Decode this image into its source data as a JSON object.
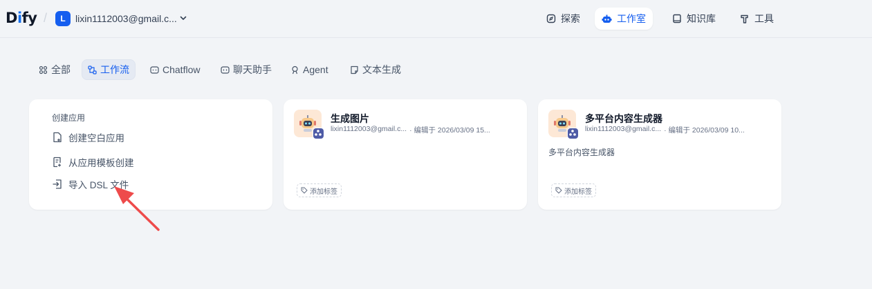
{
  "header": {
    "logo_text": "Dify",
    "workspace_initial": "L",
    "workspace_name": "lixin1112003@gmail.c...",
    "nav": [
      {
        "label": "探索",
        "icon": "compass-icon"
      },
      {
        "label": "工作室",
        "icon": "robot-icon",
        "active": true
      },
      {
        "label": "知识库",
        "icon": "book-icon"
      },
      {
        "label": "工具",
        "icon": "hammer-icon"
      }
    ]
  },
  "tabs": [
    {
      "label": "全部",
      "icon": "grid-icon"
    },
    {
      "label": "工作流",
      "icon": "workflow-icon",
      "active": true
    },
    {
      "label": "Chatflow",
      "icon": "chat-bubble-icon"
    },
    {
      "label": "聊天助手",
      "icon": "chat-bot-icon"
    },
    {
      "label": "Agent",
      "icon": "agent-icon"
    },
    {
      "label": "文本生成",
      "icon": "document-icon"
    }
  ],
  "create": {
    "title": "创建应用",
    "items": [
      {
        "label": "创建空白应用",
        "icon": "file-plus-icon"
      },
      {
        "label": "从应用模板创建",
        "icon": "template-icon"
      },
      {
        "label": "导入 DSL 文件",
        "icon": "import-icon"
      }
    ]
  },
  "apps": [
    {
      "name": "生成图片",
      "author": "lixin1112003@gmail.c...",
      "edited": "· 编辑于 2026/03/09 15...",
      "description": "",
      "tag_label": "添加标签"
    },
    {
      "name": "多平台内容生成器",
      "author": "lixin1112003@gmail.c...",
      "edited": "· 编辑于 2026/03/09 10...",
      "description": "多平台内容生成器",
      "tag_label": "添加标签"
    }
  ],
  "colors": {
    "accent": "#155eef",
    "annotation_arrow": "#ee4b4b"
  }
}
